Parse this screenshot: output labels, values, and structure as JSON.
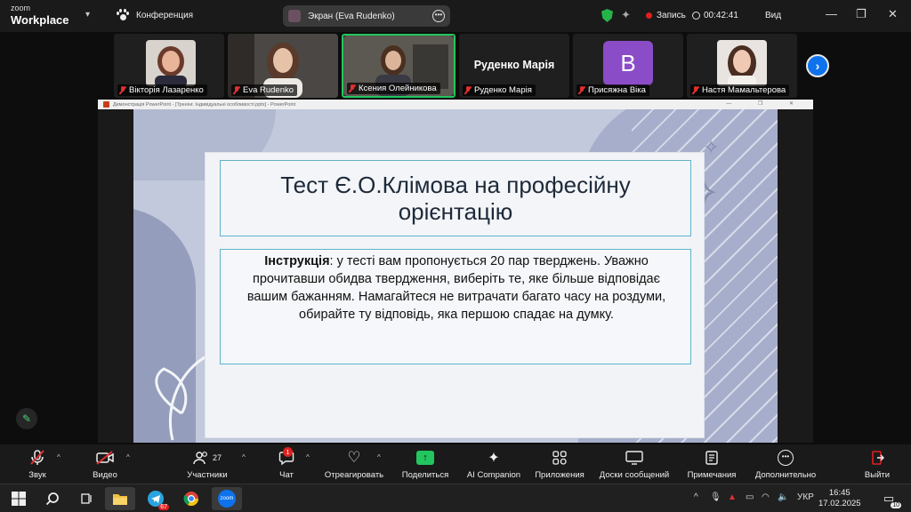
{
  "topbar": {
    "brand_small": "zoom",
    "brand_big": "Workplace",
    "meeting_label": "Конференция",
    "screen_share_label": "Экран (Eva Rudenko)",
    "recording_label": "Запись",
    "timer": "00:42:41",
    "view_label": "Вид"
  },
  "participants": [
    {
      "name": "Вікторія Лазаренко"
    },
    {
      "name": "Eva Rudenko"
    },
    {
      "name": "Ксения Олейникова"
    },
    {
      "name": "Руденко Марія",
      "big_name": "Руденко Марія"
    },
    {
      "name": "Присяжна Віка",
      "avatar_letter": "B"
    },
    {
      "name": "Настя Мамальтерова"
    }
  ],
  "powerpoint": {
    "window_title": "Демонстрація PowerPoint - [Тренінг. Індивідуальні особливості.pptx] - PowerPoint"
  },
  "slide": {
    "title": "Тест Є.О.Клімова на професійну орієнтацію",
    "instruction_label": "Інструкція",
    "instruction_text": ": у тесті вам пропонується 20 пар тверджень. Уважно прочитавши обидва твердження, виберіть те, яке більше відповідає вашим бажанням. Намагайтеся не витрачати багато часу на роздуми, обирайте ту відповідь, яка першою спадає на думку."
  },
  "toolbar": {
    "audio": "Звук",
    "video": "Видео",
    "participants": "Участники",
    "participants_count": "27",
    "chat": "Чат",
    "chat_badge": "1",
    "react": "Отреагировать",
    "share": "Поделиться",
    "ai": "AI Companion",
    "apps": "Приложения",
    "boards": "Доски сообщений",
    "notes": "Примечания",
    "more": "Дополнительно",
    "leave": "Выйти"
  },
  "taskbar": {
    "telegram_badge": "67",
    "zoom_label": "zoom",
    "lang": "УКР",
    "time": "16:45",
    "date": "17.02.2025",
    "notif_count": "10"
  },
  "colors": {
    "accent_green": "#22c55e",
    "leave_red": "#e02020",
    "zoom_blue": "#0e72ed",
    "avatar_purple": "#8b4cc8"
  }
}
